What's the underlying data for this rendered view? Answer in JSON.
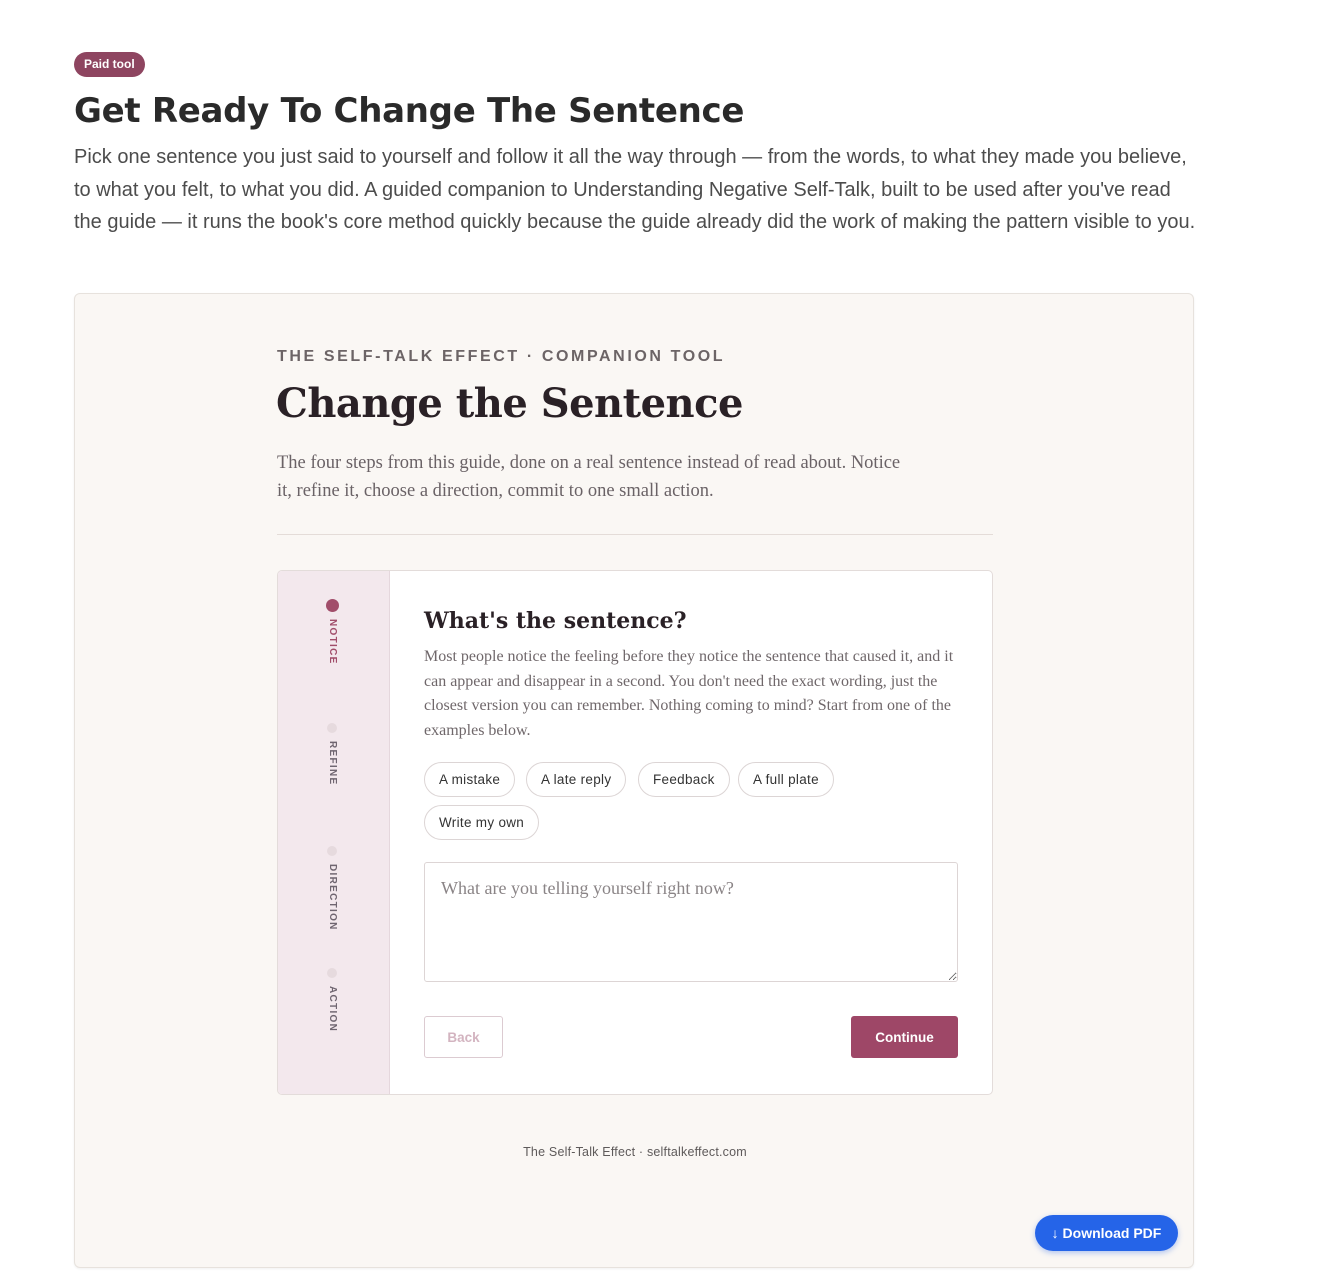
{
  "badge": "Paid tool",
  "page_title": "Get Ready To Change The Sentence",
  "intro": "Pick one sentence you just said to yourself and follow it all the way through — from the words, to what they made you believe, to what you felt, to what you did. A guided companion to Understanding Negative Self-Talk, built to be used after you've read the guide — it runs the book's core method quickly because the guide already did the work of making the pattern visible to you.",
  "tool": {
    "kicker": "THE SELF-TALK EFFECT · COMPANION TOOL",
    "title": "Change the Sentence",
    "description": "The four steps from this guide, done on a real sentence instead of read about. Notice it, refine it, choose a direction, commit to one small action."
  },
  "steps": [
    {
      "label": "NOTICE",
      "active": true
    },
    {
      "label": "REFINE",
      "active": false
    },
    {
      "label": "DIRECTION",
      "active": false
    },
    {
      "label": "ACTION",
      "active": false
    }
  ],
  "question": {
    "title": "What's the sentence?",
    "description": "Most people notice the feeling before they notice the sentence that caused it, and it can appear and disappear in a second. You don't need the exact wording, just the closest version you can remember. Nothing coming to mind? Start from one of the examples below.",
    "chips": [
      "A mistake",
      "A late reply",
      "Feedback",
      "A full plate",
      "Write my own"
    ],
    "input_placeholder": "What are you telling yourself right now?",
    "input_value": ""
  },
  "buttons": {
    "back": "Back",
    "continue": "Continue"
  },
  "footer": "The Self-Talk Effect · selftalkeffect.com",
  "download": "↓ Download PDF",
  "colors": {
    "accent": "#9e4767",
    "badge": "#8e4560",
    "download": "#2564e8"
  }
}
